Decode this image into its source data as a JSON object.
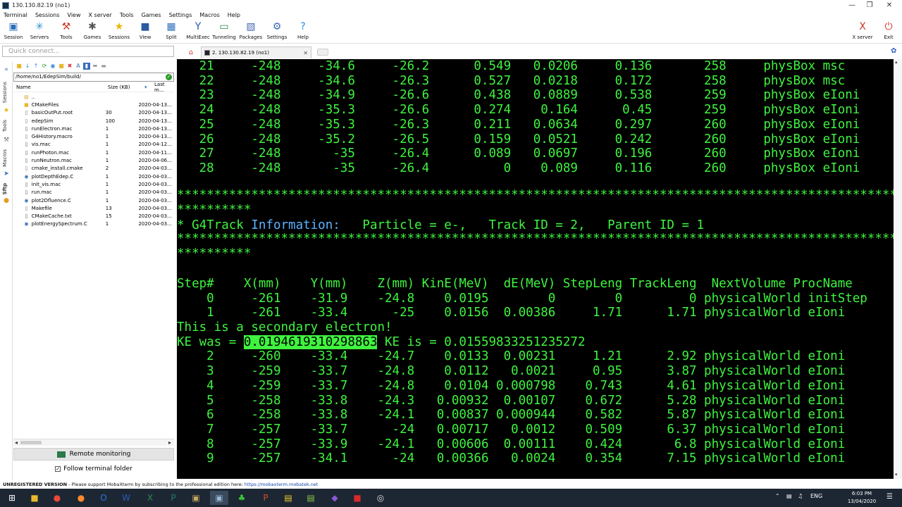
{
  "window": {
    "title": "130.130.82.19 (no1)",
    "minimize": "—",
    "restore": "❐",
    "close": "✕"
  },
  "menu": [
    "Terminal",
    "Sessions",
    "View",
    "X server",
    "Tools",
    "Games",
    "Settings",
    "Macros",
    "Help"
  ],
  "toolbar": [
    {
      "label": "Session",
      "icon": "session-icon",
      "glyph": "▣",
      "color": "#2a6ebb"
    },
    {
      "label": "Servers",
      "icon": "servers-icon",
      "glyph": "✳",
      "color": "#2a8fd0"
    },
    {
      "label": "Tools",
      "icon": "tools-icon",
      "glyph": "⚒",
      "color": "#c83a2a"
    },
    {
      "label": "Games",
      "icon": "games-icon",
      "glyph": "✱",
      "color": "#555555"
    },
    {
      "label": "Sessions",
      "icon": "star-icon",
      "glyph": "★",
      "color": "#e8b400"
    },
    {
      "label": "View",
      "icon": "view-icon",
      "glyph": "■",
      "color": "#2a5aa0"
    },
    {
      "label": "Split",
      "icon": "split-icon",
      "glyph": "▦",
      "color": "#2a6ebb"
    },
    {
      "label": "MultiExec",
      "icon": "multiexec-icon",
      "glyph": "Y",
      "color": "#2a5aa0"
    },
    {
      "label": "Tunneling",
      "icon": "tunneling-icon",
      "glyph": "▭",
      "color": "#2a8a4a"
    },
    {
      "label": "Packages",
      "icon": "packages-icon",
      "glyph": "▧",
      "color": "#4a6ab0"
    },
    {
      "label": "Settings",
      "icon": "settings-icon",
      "glyph": "⚙",
      "color": "#3a6ab8"
    },
    {
      "label": "Help",
      "icon": "help-icon",
      "glyph": "?",
      "color": "#2a8ae8"
    }
  ],
  "toolbar_right": [
    {
      "label": "X server",
      "icon": "x-server-icon",
      "glyph": "X",
      "color": "#c83a2a"
    },
    {
      "label": "Exit",
      "icon": "exit-icon",
      "glyph": "⏻",
      "color": "#d83a2a"
    }
  ],
  "quick_connect": {
    "placeholder": "Quick connect..."
  },
  "tab": {
    "label": "2. 130.130.82.19 (no1)",
    "close": "✕"
  },
  "side_tabs": [
    "Sessions",
    "Tools",
    "Macros",
    "Sftp"
  ],
  "file_browser": {
    "path": "/home/no1/EdepSim/build/",
    "columns": {
      "name": "Name",
      "size": "Size (KB)",
      "modified": "Last m..."
    },
    "files": [
      {
        "name": "..",
        "size": "",
        "date": "",
        "icon": "folder-up-icon",
        "glyph": "▤",
        "color": "#d8a020"
      },
      {
        "name": "CMakeFiles",
        "size": "",
        "date": "2020-04-13...",
        "icon": "folder-icon",
        "glyph": "■",
        "color": "#e8b830"
      },
      {
        "name": "basicOutPut.root",
        "size": "30",
        "date": "2020-04-13...",
        "icon": "file-icon",
        "glyph": "▯",
        "color": "#777777"
      },
      {
        "name": "edepSim",
        "size": "100",
        "date": "2020-04-13...",
        "icon": "file-icon",
        "glyph": "▯",
        "color": "#777777"
      },
      {
        "name": "runElectron.mac",
        "size": "1",
        "date": "2020-04-13...",
        "icon": "text-file-icon",
        "glyph": "▯",
        "color": "#555555"
      },
      {
        "name": "G4History.macro",
        "size": "1",
        "date": "2020-04-13...",
        "icon": "file-icon",
        "glyph": "▯",
        "color": "#777777"
      },
      {
        "name": "vis.mac",
        "size": "1",
        "date": "2020-04-12...",
        "icon": "text-file-icon",
        "glyph": "▯",
        "color": "#555555"
      },
      {
        "name": "runPhoton.mac",
        "size": "1",
        "date": "2020-04-11...",
        "icon": "text-file-icon",
        "glyph": "▯",
        "color": "#555555"
      },
      {
        "name": "runNeutron.mac",
        "size": "1",
        "date": "2020-04-06...",
        "icon": "text-file-icon",
        "glyph": "▯",
        "color": "#555555"
      },
      {
        "name": "cmake_install.cmake",
        "size": "2",
        "date": "2020-04-03...",
        "icon": "file-icon",
        "glyph": "▯",
        "color": "#777777"
      },
      {
        "name": "plotDepthEdep.C",
        "size": "1",
        "date": "2020-04-03...",
        "icon": "c-file-icon",
        "glyph": "◉",
        "color": "#3a6ab8"
      },
      {
        "name": "init_vis.mac",
        "size": "1",
        "date": "2020-04-03...",
        "icon": "text-file-icon",
        "glyph": "▯",
        "color": "#555555"
      },
      {
        "name": "run.mac",
        "size": "1",
        "date": "2020-04-03...",
        "icon": "text-file-icon",
        "glyph": "▯",
        "color": "#555555"
      },
      {
        "name": "plot2Dfluence.C",
        "size": "1",
        "date": "2020-04-03...",
        "icon": "c-file-icon",
        "glyph": "◉",
        "color": "#3a6ab8"
      },
      {
        "name": "Makefile",
        "size": "13",
        "date": "2020-04-03...",
        "icon": "file-icon",
        "glyph": "▯",
        "color": "#777777"
      },
      {
        "name": "CMakeCache.txt",
        "size": "15",
        "date": "2020-04-03...",
        "icon": "text-file-icon",
        "glyph": "▯",
        "color": "#555555"
      },
      {
        "name": "plotEnergySpectrum.C",
        "size": "1",
        "date": "2020-04-03...",
        "icon": "c-file-icon",
        "glyph": "◉",
        "color": "#3a6ab8"
      }
    ]
  },
  "remote_monitoring": "Remote monitoring",
  "follow_folder": "Follow terminal folder",
  "terminal": {
    "lines": [
      "   21     -248     -34.6     -26.2      0.549   0.0206     0.136       258     physBox msc",
      "   22     -248     -34.6     -26.3      0.527   0.0218     0.172       258     physBox msc",
      "   23     -248     -34.9     -26.6      0.438   0.0889     0.538       259     physBox eIoni",
      "   24     -248     -35.3     -26.6      0.274    0.164      0.45       259     physBox eIoni",
      "   25     -248     -35.3     -26.3      0.211   0.0634     0.297       260     physBox eIoni",
      "   26     -248     -35.2     -26.5      0.159   0.0521     0.242       260     physBox eIoni",
      "   27     -248       -35     -26.4      0.089   0.0697     0.196       260     physBox eIoni",
      "   28     -248       -35     -26.4          0    0.089     0.116       260     physBox eIoni",
      "",
      "*************************************************************************************************",
      "**********",
      "* G4Track |Information:|   Particle = e-,   Track ID = 2,   Parent ID = 1",
      "*************************************************************************************************",
      "**********",
      "",
      "",
      "Step#    X(mm)    Y(mm)    Z(mm) KinE(MeV)  dE(MeV) StepLeng TrackLeng  NextVolume ProcName",
      "    0     -261    -31.9    -24.8    0.0195        0        0         0 physicalWorld initStep",
      "    1     -261    -33.4      -25    0.0156  0.00386     1.71      1.71 physicalWorld eIoni",
      "This is a secondary electron!",
      "KE was = [[0.0194619310298863]] KE is = 0.0155983325123527​2",
      "    2     -260    -33.4    -24.7    0.0133  0.00231     1.21      2.92 physicalWorld eIoni",
      "    3     -259    -33.7    -24.8    0.0112   0.0021     0.95      3.87 physicalWorld eIoni",
      "    4     -259    -33.7    -24.8    0.0104 0.000798    0.743      4.61 physicalWorld eIoni",
      "    5     -258    -33.8    -24.3   0.00932  0.00107    0.672      5.28 physicalWorld eIoni",
      "    6     -258    -33.8    -24.1   0.00837 0.000944    0.582      5.87 physicalWorld eIoni",
      "    7     -257    -33.7      -24   0.00717   0.0012    0.509      6.37 physicalWorld eIoni",
      "    8     -257    -33.9    -24.1   0.00606  0.00111    0.424       6.8 physicalWorld eIoni",
      "    9     -257    -34.1      -24   0.00366   0.0024    0.354      7.15 physicalWorld eIoni"
    ]
  },
  "status": {
    "unregistered": "UNREGISTERED VERSION",
    "message": " -  Please support MobaXterm by subscribing to the professional edition here: ",
    "url": "https://mobaxterm.mobatek.net"
  },
  "taskbar": {
    "apps": [
      {
        "icon": "windows-start-icon",
        "glyph": "⊞",
        "color": "#ffffff"
      },
      {
        "icon": "file-explorer-icon",
        "glyph": "■",
        "color": "#e8b830"
      },
      {
        "icon": "chrome-icon",
        "glyph": "●",
        "color": "#e84a3a"
      },
      {
        "icon": "firefox-icon",
        "glyph": "●",
        "color": "#ff8a2a"
      },
      {
        "icon": "outlook-icon",
        "glyph": "O",
        "color": "#2a78d8"
      },
      {
        "icon": "word-icon",
        "glyph": "W",
        "color": "#2a5ab8"
      },
      {
        "icon": "excel-icon",
        "glyph": "X",
        "color": "#2a8a4a"
      },
      {
        "icon": "publisher-icon",
        "glyph": "P",
        "color": "#2a7a6a"
      },
      {
        "icon": "app-icon",
        "glyph": "▣",
        "color": "#c8a860"
      },
      {
        "icon": "mobaxterm-icon",
        "glyph": "▣",
        "color": "#9ab8d8"
      },
      {
        "icon": "tree-icon",
        "glyph": "♣",
        "color": "#3ac83a"
      },
      {
        "icon": "powerpoint-icon",
        "glyph": "P",
        "color": "#d84a2a"
      },
      {
        "icon": "app-icon",
        "glyph": "▤",
        "color": "#e8c830"
      },
      {
        "icon": "notepad-icon",
        "glyph": "▤",
        "color": "#8ac848"
      },
      {
        "icon": "visual-studio-icon",
        "glyph": "◆",
        "color": "#8a5ad8"
      },
      {
        "icon": "acrobat-icon",
        "glyph": "■",
        "color": "#d82a2a"
      },
      {
        "icon": "app-icon",
        "glyph": "◎",
        "color": "#dddddd"
      }
    ],
    "language": "ENG",
    "time": "6:03 PM",
    "date": "13/04/2020"
  }
}
